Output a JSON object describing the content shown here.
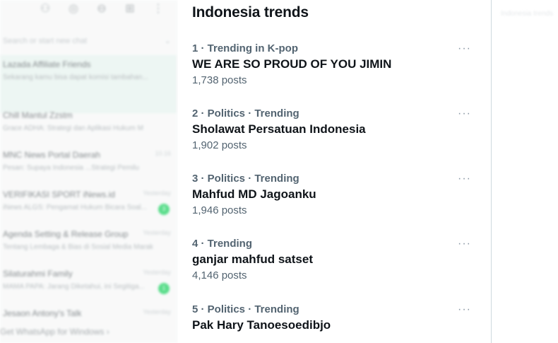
{
  "sidebar": {
    "search_placeholder": "Search or start new chat",
    "chats": [
      {
        "name": "Lazada Affiliate Friends",
        "preview": "Sekarang kamu bisa dapat komisi tambahan...",
        "time": "",
        "badge": "",
        "active": true
      },
      {
        "name": "Chill Mantul Zzstm",
        "preview": "Grace ADHA: Strategi dan Aplikasi Hukum M",
        "time": "",
        "badge": ""
      },
      {
        "name": "MNC News Portal Daerah",
        "preview": "Pesan: Supaya Indonesia ...Strategi Pemilu",
        "time": "10.16",
        "badge": ""
      },
      {
        "name": "VERIFIKASI SPORT iNews.id",
        "preview": "iNews ALGS: Pengamat Hukum Bicara Soal...",
        "time": "Yesterday",
        "badge": "3"
      },
      {
        "name": "Agenda Setting & Release Group",
        "preview": "Tentang Lembaga & Bias di Sosial Media Marak",
        "time": "Yesterday",
        "badge": ""
      },
      {
        "name": "Silaturahmi Family",
        "preview": "MAMA PAPA: Jarang Diketahui, ini Segitiga...",
        "time": "Yesterday",
        "badge": "1"
      },
      {
        "name": "Jesaon Antony's Talk",
        "preview": "",
        "time": "Yesterday",
        "badge": ""
      }
    ],
    "footer": "Get WhatsApp for Windows ›"
  },
  "trends": {
    "title": "Indonesia trends",
    "items": [
      {
        "meta": "1 · Trending in K-pop",
        "topic": "WE ARE SO PROUD OF YOU JIMIN",
        "count": "1,738 posts"
      },
      {
        "meta": "2 · Politics · Trending",
        "topic": "Sholawat Persatuan Indonesia",
        "count": "1,902 posts"
      },
      {
        "meta": "3 · Politics · Trending",
        "topic": "Mahfud MD Jagoanku",
        "count": "1,946 posts"
      },
      {
        "meta": "4 · Trending",
        "topic": "ganjar mahfud satset",
        "count": "4,146 posts"
      },
      {
        "meta": "5 · Politics · Trending",
        "topic": "Pak Hary Tanoesoedibjo",
        "count": ""
      }
    ],
    "more_glyph": "···"
  },
  "right": {
    "ghost_text": "Indonesia trends"
  },
  "icons": [
    "community-icon",
    "status-icon",
    "channels-icon",
    "new-chat-icon",
    "menu-icon",
    "more-icon"
  ],
  "colors": {
    "primary_text": "#0f1419",
    "secondary_text": "#536471",
    "divider": "#cfd9de",
    "active_chat": "#e7f3ef"
  }
}
